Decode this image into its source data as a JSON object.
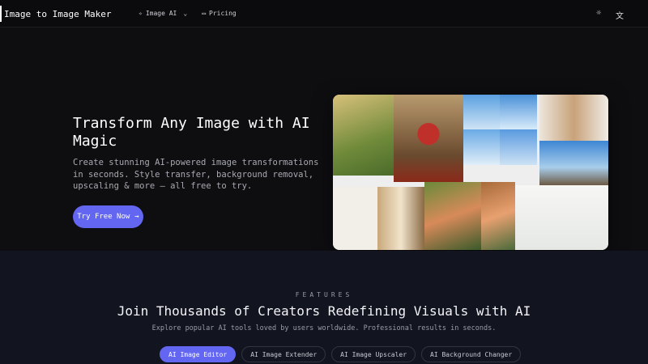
{
  "header": {
    "brand": "Image to Image Maker",
    "nav": [
      {
        "label": "Image AI",
        "icon": "sparkle-icon"
      },
      {
        "label": "Pricing",
        "icon": "card-icon"
      }
    ],
    "theme_icon": "sun-icon",
    "language_icon": "translate-icon"
  },
  "hero": {
    "title": "Transform Any Image with AI Magic",
    "subtitle": "Create stunning AI-powered image transformations in seconds. Style transfer, background removal, upscaling & more — all free to try.",
    "cta": "Try Free Now",
    "cta_icon": "arrow-right-icon"
  },
  "features": {
    "eyebrow": "FEATURES",
    "title": "Join Thousands of Creators Redefining Visuals with AI",
    "description": "Explore popular AI tools loved by users worldwide. Professional results in seconds.",
    "tabs": [
      {
        "label": "AI Image Editor",
        "active": true
      },
      {
        "label": "AI Image Extender",
        "active": false
      },
      {
        "label": "AI Image Upscaler",
        "active": false
      },
      {
        "label": "AI Background Changer",
        "active": false
      }
    ]
  },
  "colors": {
    "accent": "#6366f1",
    "background": "#0e0e11",
    "features_bg": "#12141f"
  }
}
